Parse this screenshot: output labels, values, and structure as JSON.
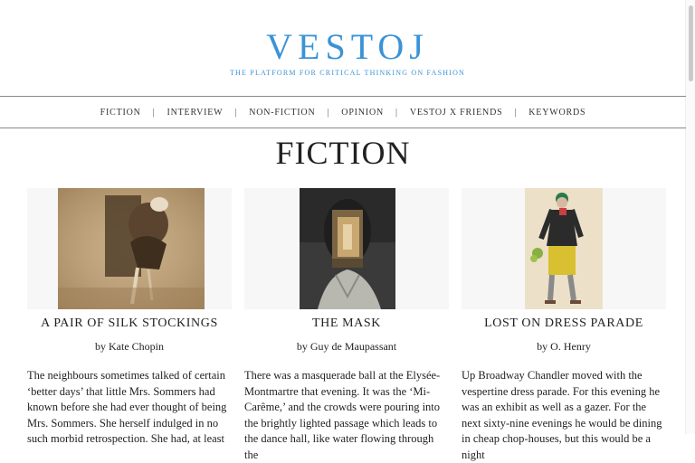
{
  "brand": {
    "logo": "VESTOJ",
    "tagline": "THE PLATFORM FOR CRITICAL THINKING ON FASHION",
    "color": "#3a93d6"
  },
  "nav": {
    "items": [
      "FICTION",
      "INTERVIEW",
      "NON-FICTION",
      "OPINION",
      "VESTOJ X FRIENDS",
      "KEYWORDS"
    ],
    "separator": "|"
  },
  "page": {
    "title": "FICTION"
  },
  "articles": [
    {
      "title": "A PAIR OF SILK STOCKINGS",
      "author": "by Kate Chopin",
      "excerpt": "The neighbours sometimes talked of certain ‘better days’ that little Mrs. Sommers had known before she had ever thought of being Mrs. Sommers. She herself indulged in no such morbid retrospection. She had, at least"
    },
    {
      "title": "THE MASK",
      "author": "by Guy de Maupassant",
      "excerpt": "There was a masquerade ball at the Elysée-Montmartre that evening. It was the ‘Mi-Carême,’ and the crowds were pouring into the brightly lighted passage which leads to the dance hall, like water flowing through the"
    },
    {
      "title": "LOST ON DRESS PARADE",
      "author": "by O. Henry",
      "excerpt": "Up Broadway Chandler moved with the vespertine dress parade. For this evening he was an exhibit as well as a gazer. For the next sixty-nine evenings he would be dining in cheap chop-houses, but this would be a night"
    }
  ]
}
